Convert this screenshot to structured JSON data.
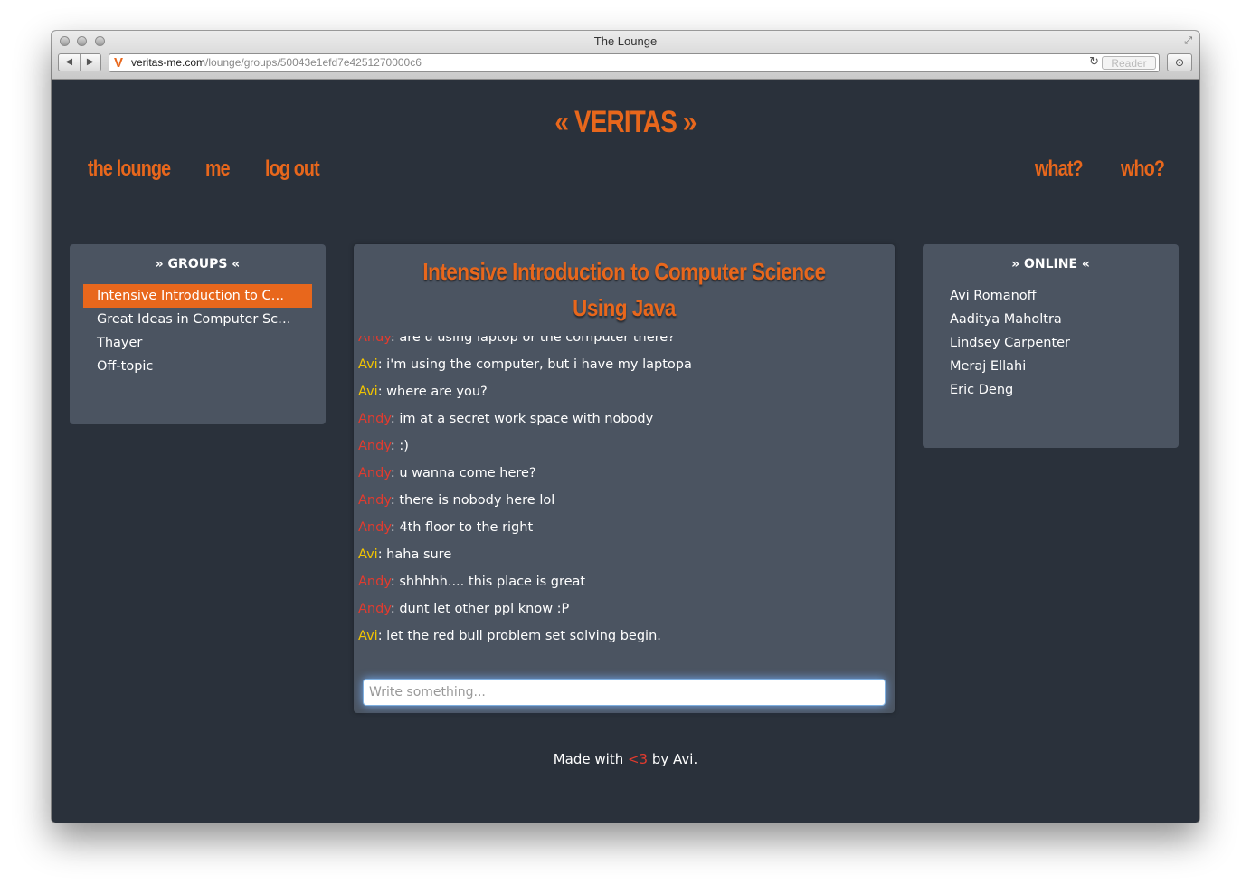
{
  "browser": {
    "title": "The Lounge",
    "url_host": "veritas-me.com",
    "url_path": "/lounge/groups/50043e1efd7e4251270000c6",
    "back_glyph": "◀",
    "forward_glyph": "▶",
    "favicon_letter": "V",
    "reload_glyph": "↻",
    "reader_label": "Reader",
    "resize_glyph": "⤢",
    "download_glyph": "⊙"
  },
  "site": {
    "logo": "« VERITAS »",
    "nav_left": [
      "the lounge",
      "me",
      "log out"
    ],
    "nav_right": [
      "what?",
      "who?"
    ]
  },
  "groups": {
    "heading": "» GROUPS «",
    "items": [
      "Intensive Introduction to C…",
      "Great Ideas in Computer Sc…",
      "Thayer",
      "Off-topic"
    ]
  },
  "online": {
    "heading": "» ONLINE «",
    "users": [
      "Avi Romanoff",
      "Aaditya Maholtra",
      "Lindsey Carpenter",
      "Meraj Ellahi",
      "Eric Deng"
    ]
  },
  "chat": {
    "title": "Intensive Introduction to Computer Science Using Java",
    "input_placeholder": "Write something...",
    "messages": [
      {
        "author": "Andy",
        "text": ": are u using laptop or the computer there?"
      },
      {
        "author": "Avi",
        "text": ": i'm using the computer, but i have my laptopa"
      },
      {
        "author": "Avi",
        "text": ": where are you?"
      },
      {
        "author": "Andy",
        "text": ": im at a secret work space with nobody"
      },
      {
        "author": "Andy",
        "text": ": :)"
      },
      {
        "author": "Andy",
        "text": ": u wanna come here?"
      },
      {
        "author": "Andy",
        "text": ": there is nobody here lol"
      },
      {
        "author": "Andy",
        "text": ": 4th floor to the right"
      },
      {
        "author": "Avi",
        "text": ": haha sure"
      },
      {
        "author": "Andy",
        "text": ": shhhhh.... this place is great"
      },
      {
        "author": "Andy",
        "text": ": dunt let other ppl know :P"
      },
      {
        "author": "Avi",
        "text": ": let the red bull problem set solving begin."
      }
    ]
  },
  "footer": {
    "prefix": "Made with ",
    "heart": "<3",
    "suffix": " by Avi."
  },
  "colors": {
    "accent": "#e8671c",
    "background": "#2a313b",
    "panel": "#4b5461",
    "author_andy": "#e23b2e",
    "author_avi": "#f2c400"
  }
}
